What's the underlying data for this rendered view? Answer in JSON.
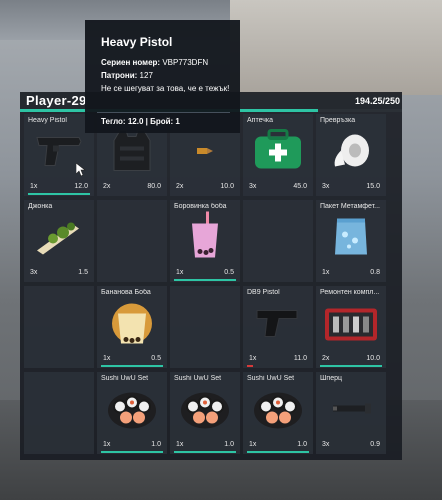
{
  "header": {
    "player_name": "Player-29",
    "weight": "194.25/250",
    "weight_fraction": 0.78
  },
  "tooltip": {
    "title": "Heavy Pistol",
    "serial_label": "Сериен номер:",
    "serial_value": "VBP773DFN",
    "ammo_label": "Патрони:",
    "ammo_value": "127",
    "description": "Не се шегуват за това, че е тежък!",
    "footer": "Тегло: 12.0 | Брой: 1"
  },
  "slots": [
    {
      "label": "Heavy Pistol",
      "qty": "1x",
      "weight": "12.0",
      "icon": "pistol-icon",
      "bar": "teal"
    },
    {
      "label": "",
      "qty": "2x",
      "weight": "80.0",
      "icon": "armor-vest-icon",
      "bar": ""
    },
    {
      "label": "",
      "qty": "2x",
      "weight": "10.0",
      "icon": "bullet-icon",
      "bar": ""
    },
    {
      "label": "Аптечка",
      "qty": "3x",
      "weight": "45.0",
      "icon": "medkit-icon",
      "bar": ""
    },
    {
      "label": "Превръзка",
      "qty": "3x",
      "weight": "15.0",
      "icon": "bandage-icon",
      "bar": ""
    },
    {
      "label": "Джонка",
      "qty": "3x",
      "weight": "1.5",
      "icon": "joint-icon",
      "bar": ""
    },
    {
      "label": "",
      "qty": "",
      "weight": "",
      "icon": "",
      "bar": ""
    },
    {
      "label": "Боровинка боба",
      "qty": "1x",
      "weight": "0.5",
      "icon": "bubble-tea-icon",
      "bar": "teal"
    },
    {
      "label": "",
      "qty": "",
      "weight": "",
      "icon": "",
      "bar": ""
    },
    {
      "label": "Пакет Метамфет...",
      "qty": "1x",
      "weight": "0.8",
      "icon": "meth-bag-icon",
      "bar": ""
    },
    {
      "label": "",
      "qty": "",
      "weight": "",
      "icon": "",
      "bar": ""
    },
    {
      "label": "Бананова Боба",
      "qty": "1x",
      "weight": "0.5",
      "icon": "banana-boba-icon",
      "bar": "teal"
    },
    {
      "label": "",
      "qty": "",
      "weight": "",
      "icon": "",
      "bar": ""
    },
    {
      "label": "DB9 Pistol",
      "qty": "1x",
      "weight": "11.0",
      "icon": "db9-pistol-icon",
      "bar": "red"
    },
    {
      "label": "Ремонтен компл...",
      "qty": "2x",
      "weight": "10.0",
      "icon": "repair-kit-icon",
      "bar": "teal"
    },
    {
      "label": "",
      "qty": "",
      "weight": "",
      "icon": "",
      "bar": ""
    },
    {
      "label": "Sushi UwU Set",
      "qty": "1x",
      "weight": "1.0",
      "icon": "sushi-icon",
      "bar": "teal"
    },
    {
      "label": "Sushi UwU Set",
      "qty": "1x",
      "weight": "1.0",
      "icon": "sushi-icon",
      "bar": "teal"
    },
    {
      "label": "Sushi UwU Set",
      "qty": "1x",
      "weight": "1.0",
      "icon": "sushi-icon",
      "bar": "teal"
    },
    {
      "label": "Шперц",
      "qty": "3x",
      "weight": "0.9",
      "icon": "lockpick-icon",
      "bar": ""
    }
  ],
  "colors": {
    "accent": "#2ec4a4",
    "danger": "#d63a3a",
    "panel": "#181c22"
  }
}
